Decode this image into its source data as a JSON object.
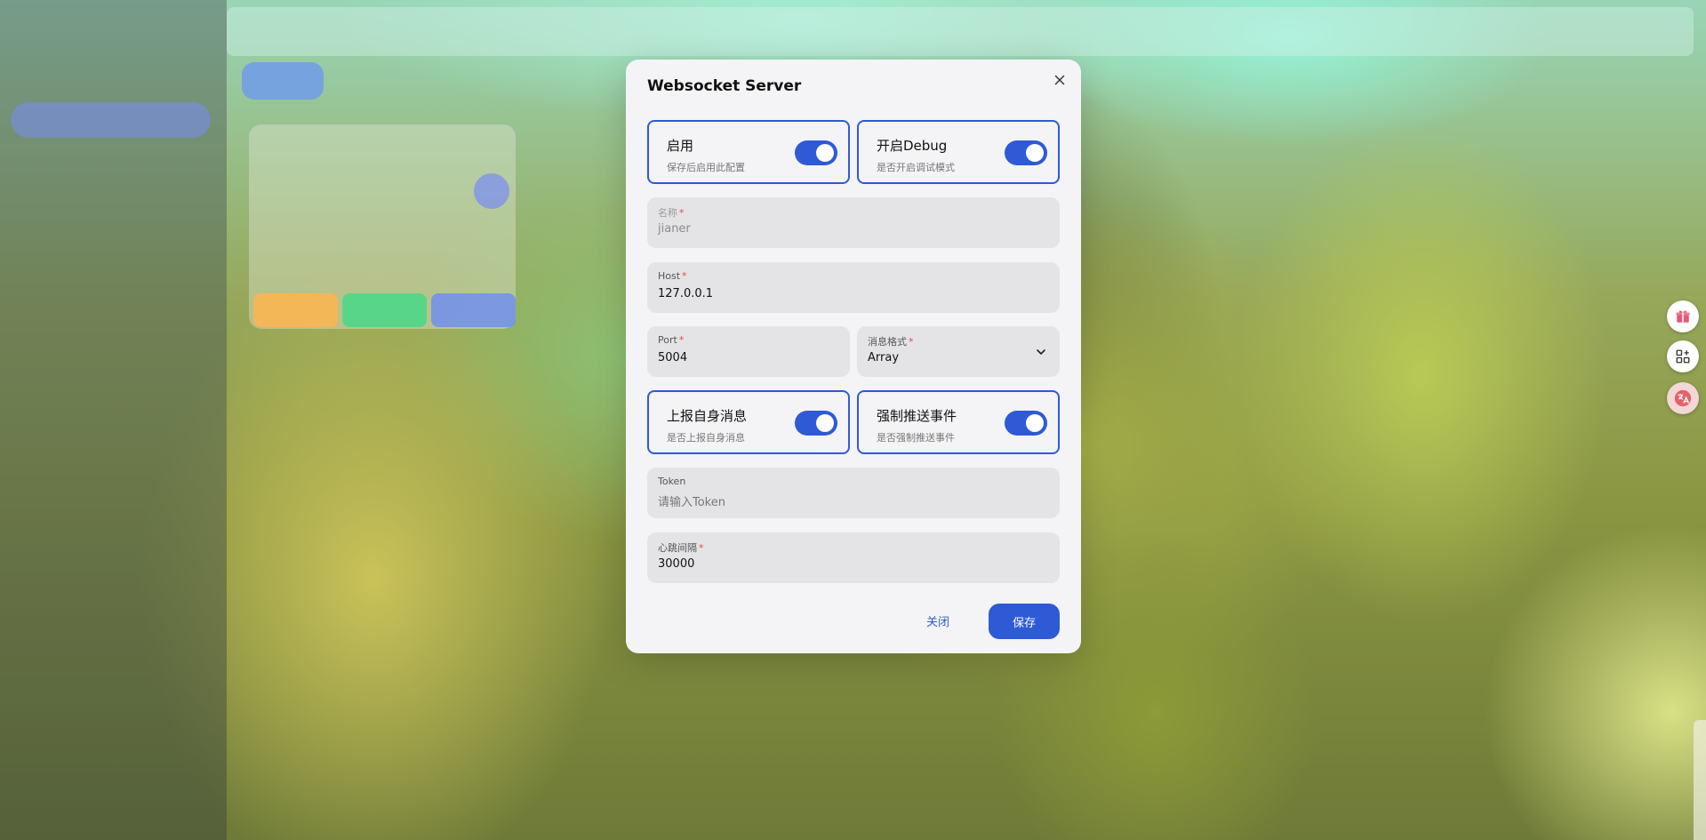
{
  "modal": {
    "title": "Websocket Server",
    "toggles": {
      "enable": {
        "label": "启用",
        "description": "保存后启用此配置",
        "on": true
      },
      "debug": {
        "label": "开启Debug",
        "description": "是否开启调试模式",
        "on": true
      },
      "report_self": {
        "label": "上报自身消息",
        "description": "是否上报自身消息",
        "on": true
      },
      "force_push": {
        "label": "强制推送事件",
        "description": "是否强制推送事件",
        "on": true
      }
    },
    "fields": {
      "name": {
        "label": "名称",
        "required_mark": "*",
        "value": "jianer"
      },
      "host": {
        "label": "Host",
        "required_mark": "*",
        "value": "127.0.0.1"
      },
      "port": {
        "label": "Port",
        "required_mark": "*",
        "value": "5004"
      },
      "message_format": {
        "label": "消息格式",
        "required_mark": "*",
        "value": "Array"
      },
      "token": {
        "label": "Token",
        "placeholder": "请输入Token"
      },
      "heartbeat": {
        "label": "心跳间隔",
        "required_mark": "*",
        "value": "30000"
      }
    },
    "buttons": {
      "close": "关闭",
      "save": "保存"
    }
  },
  "colors": {
    "accent": "#2e5ad6",
    "modal_bg": "#f4f4f6",
    "field_bg": "#e4e4e7",
    "required": "#e5484d"
  },
  "icons": {
    "close": "close-icon",
    "dropdown": "chevron-down-icon",
    "gift": "gift-icon",
    "apps": "apps-grid-icon",
    "translate": "translate-icon"
  }
}
